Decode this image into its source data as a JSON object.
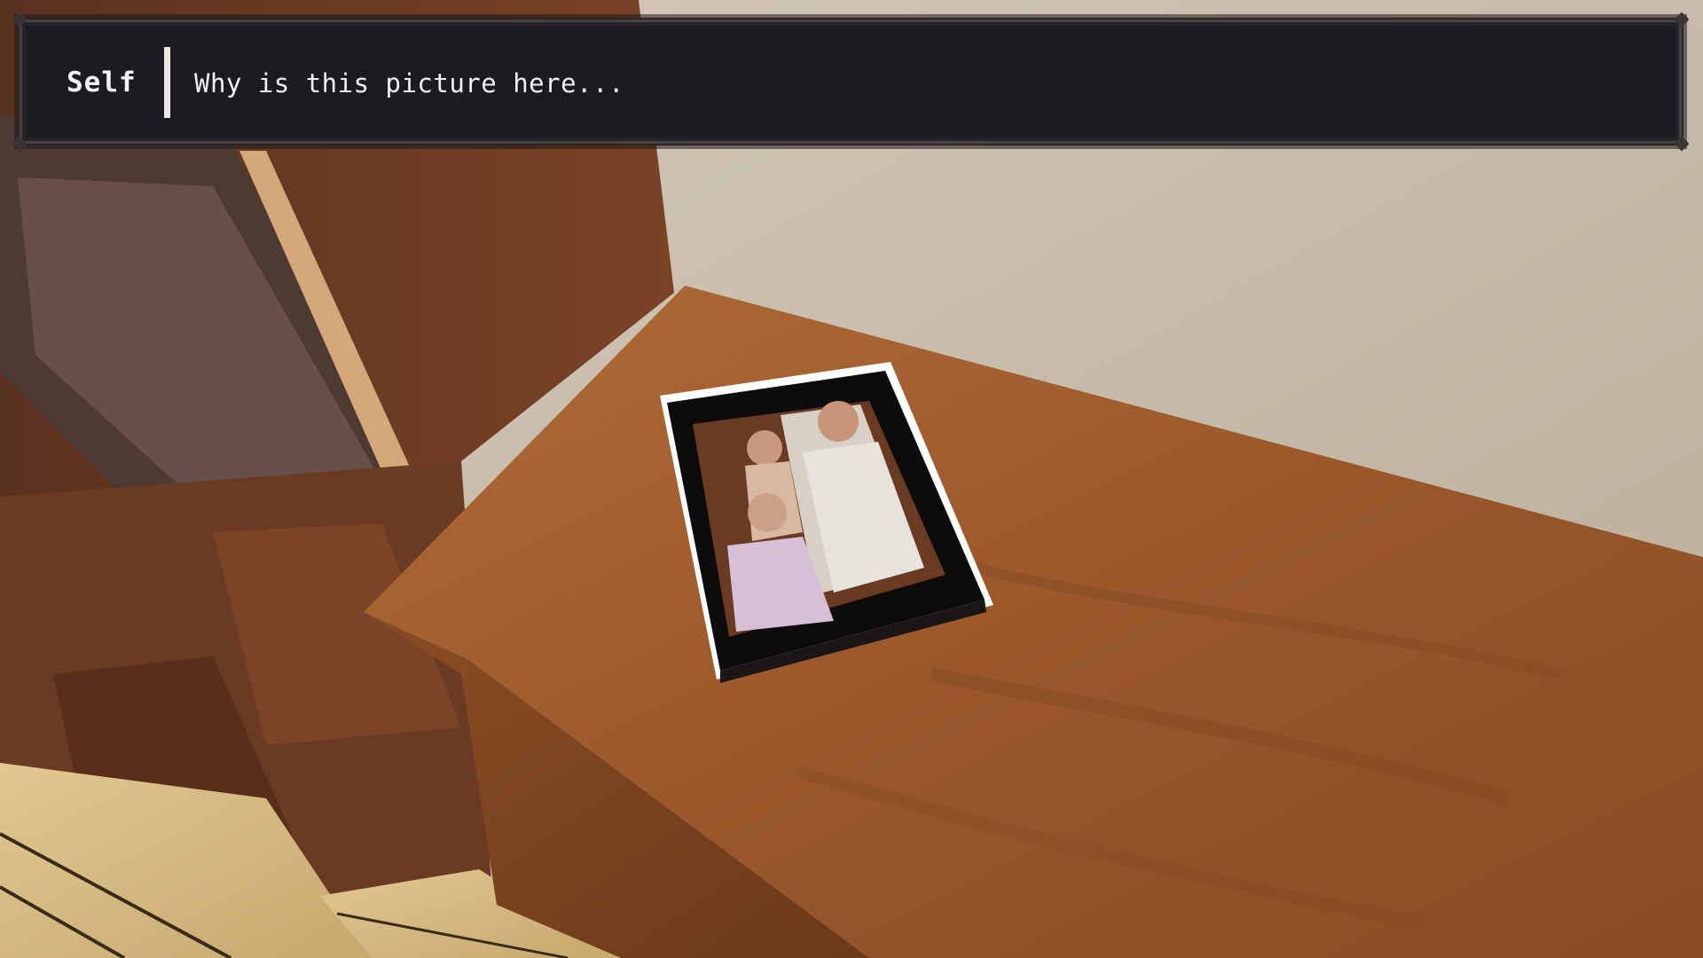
{
  "dialogue": {
    "speaker": "Self",
    "text": "Why is this picture here..."
  },
  "scene": {
    "colors": {
      "wall": "#c9bda9",
      "desk_top": "#9c5a2c",
      "desk_front": "#7a4420",
      "cabinet": "#6a3a22",
      "floor": "#d9c08a",
      "frame": "#0d0b0b",
      "frame_edge": "#ffffff"
    },
    "icons": [
      "photo-frame",
      "family-photo"
    ]
  }
}
